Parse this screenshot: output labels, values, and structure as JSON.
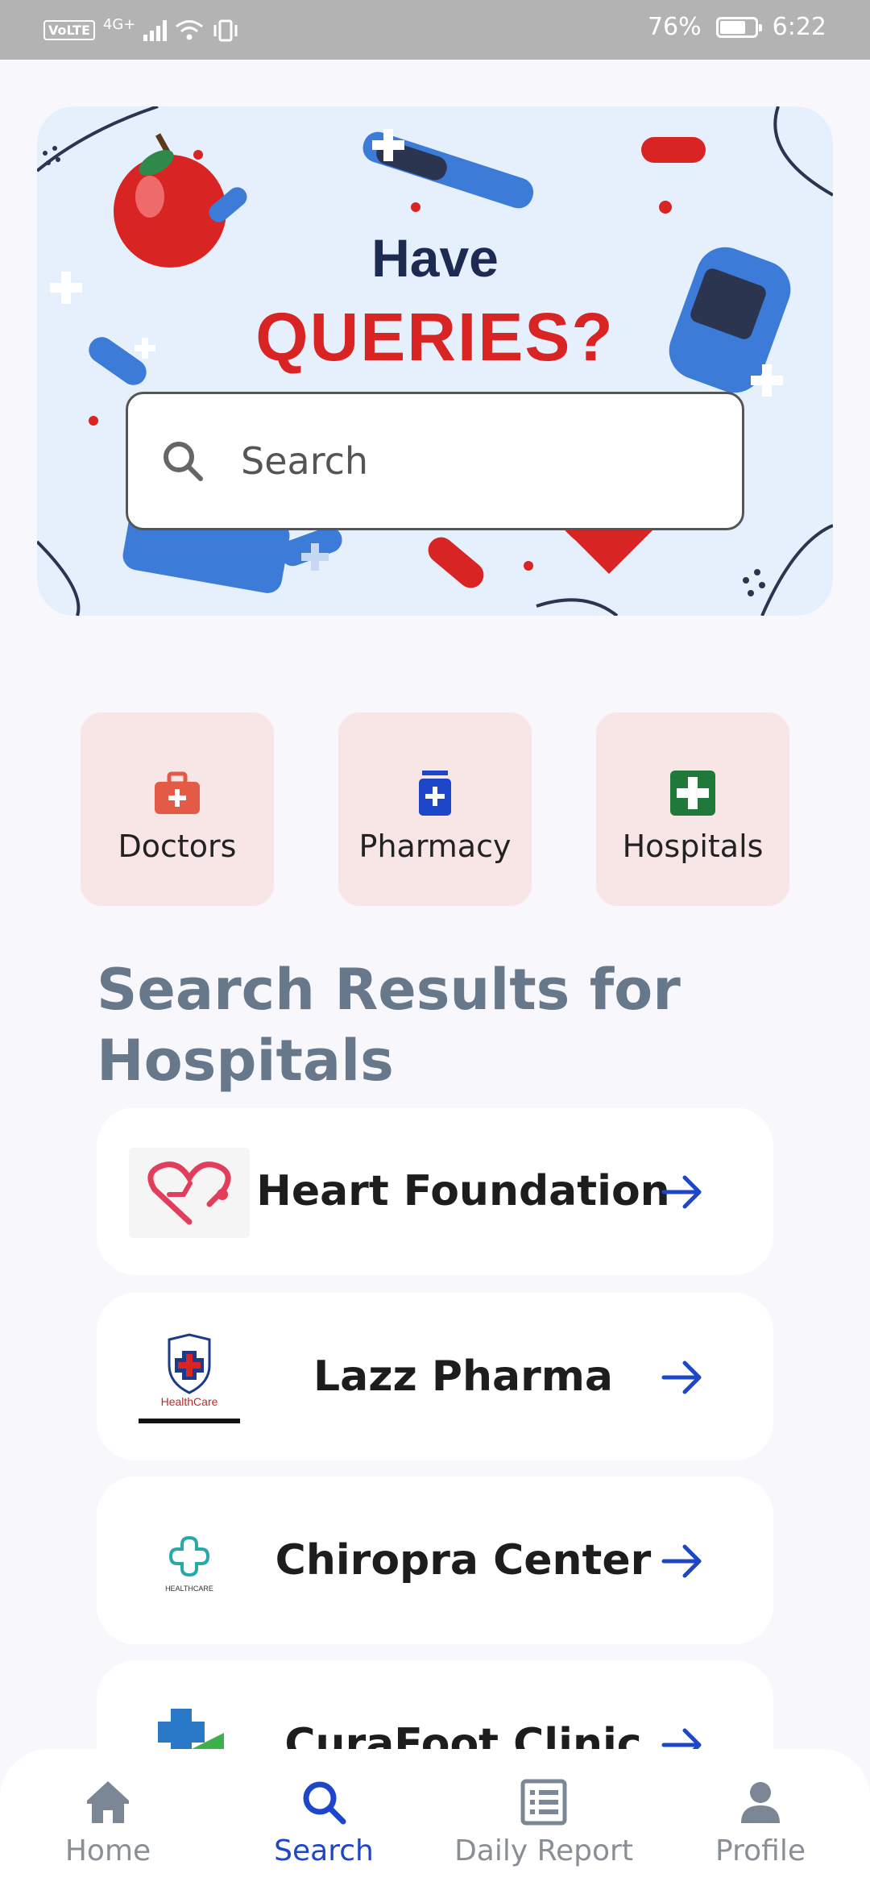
{
  "status_bar": {
    "network": "4G+",
    "volte": "VoLTE",
    "battery": "76%",
    "battery_level": 0.76,
    "time": "6:22"
  },
  "banner": {
    "line1": "Have",
    "line2": "QUERIES?"
  },
  "search": {
    "placeholder": "Search"
  },
  "categories": [
    {
      "label": "Doctors",
      "icon": "medical-bag-icon",
      "color": "#e35b45"
    },
    {
      "label": "Pharmacy",
      "icon": "medicine-bottle-icon",
      "color": "#1e46c8"
    },
    {
      "label": "Hospitals",
      "icon": "hospital-cross-icon",
      "color": "#1f7a3a"
    }
  ],
  "results": {
    "title": "Search Results for Hospitals",
    "items": [
      {
        "name": "Heart Foundation",
        "logo": "heart-foundation-logo"
      },
      {
        "name": "Lazz Pharma",
        "logo": "healthcare-shield-logo",
        "logo_text": "HealthCare"
      },
      {
        "name": "Chiropra Center",
        "logo": "healthcare-cross-logo",
        "logo_text": "HEALTHCARE"
      },
      {
        "name": "CuraFoot Clinic",
        "logo": "curafoot-logo"
      }
    ]
  },
  "nav": {
    "items": [
      {
        "label": "Home",
        "icon": "home-icon"
      },
      {
        "label": "Search",
        "icon": "search-icon",
        "active": true
      },
      {
        "label": "Daily Report",
        "icon": "report-icon"
      },
      {
        "label": "Profile",
        "icon": "profile-icon"
      }
    ]
  },
  "colors": {
    "accent": "#1e46c8",
    "title": "#66788a",
    "category_bg": "#f8e6e6",
    "banner_red": "#d92424"
  }
}
